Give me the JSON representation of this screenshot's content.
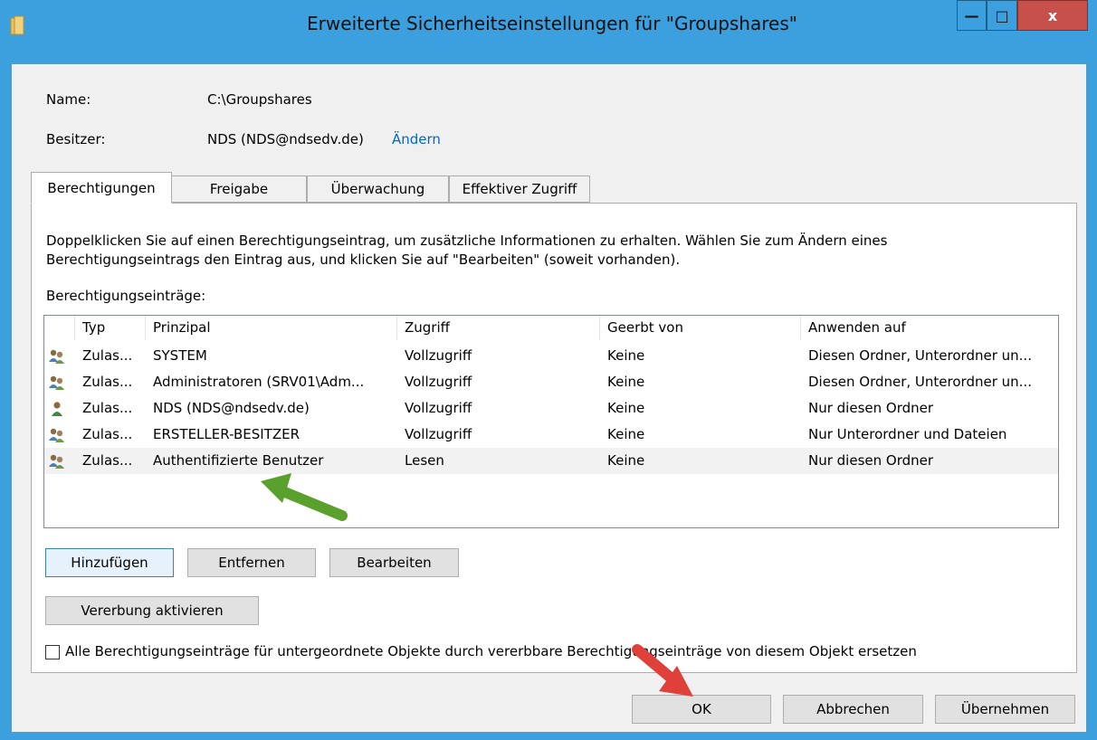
{
  "window": {
    "title": "Erweiterte Sicherheitseinstellungen für \"Groupshares\"",
    "minimize_glyph": "—",
    "maximize_glyph": "□",
    "close_glyph": "x"
  },
  "info": {
    "name_label": "Name:",
    "name_value": "C:\\Groupshares",
    "owner_label": "Besitzer:",
    "owner_value": "NDS (NDS@ndsedv.de)",
    "owner_change_link": "Ändern"
  },
  "tabs": [
    {
      "label": "Berechtigungen",
      "active": true
    },
    {
      "label": "Freigabe",
      "active": false
    },
    {
      "label": "Überwachung",
      "active": false
    },
    {
      "label": "Effektiver Zugriff",
      "active": false
    }
  ],
  "panel": {
    "description": "Doppelklicken Sie auf einen Berechtigungseintrag, um zusätzliche Informationen zu erhalten. Wählen Sie zum Ändern eines Berechtigungseintrags den Eintrag aus, und klicken Sie auf \"Bearbeiten\" (soweit vorhanden).",
    "description_line1": "Doppelklicken Sie auf einen Berechtigungseintrag, um zusätzliche Informationen zu erhalten. Wählen Sie zum Ändern eines",
    "description_line2": "Berechtigungseintrags den Eintrag aus, und klicken Sie auf \"Bearbeiten\" (soweit vorhanden).",
    "entries_label": "Berechtigungseinträge:"
  },
  "grid": {
    "columns": [
      "Typ",
      "Prinzipal",
      "Zugriff",
      "Geerbt von",
      "Anwenden auf"
    ],
    "rows": [
      {
        "icon": "group-users-icon",
        "type": "Zulas...",
        "principal": "SYSTEM",
        "access": "Vollzugriff",
        "inherited": "Keine",
        "applies": "Diesen Ordner, Unterordner un..."
      },
      {
        "icon": "group-users-icon",
        "type": "Zulas...",
        "principal": "Administratoren (SRV01\\Adm...",
        "access": "Vollzugriff",
        "inherited": "Keine",
        "applies": "Diesen Ordner, Unterordner un..."
      },
      {
        "icon": "single-user-icon",
        "type": "Zulas...",
        "principal": "NDS (NDS@ndsedv.de)",
        "access": "Vollzugriff",
        "inherited": "Keine",
        "applies": "Nur diesen Ordner"
      },
      {
        "icon": "group-users-icon",
        "type": "Zulas...",
        "principal": "ERSTELLER-BESITZER",
        "access": "Vollzugriff",
        "inherited": "Keine",
        "applies": "Nur Unterordner und Dateien"
      },
      {
        "icon": "group-users-icon",
        "type": "Zulas...",
        "principal": "Authentifizierte Benutzer",
        "access": "Lesen",
        "inherited": "Keine",
        "applies": "Nur diesen Ordner",
        "selected": true
      }
    ]
  },
  "buttons": {
    "add": "Hinzufügen",
    "remove": "Entfernen",
    "edit": "Bearbeiten",
    "enable_inheritance": "Vererbung aktivieren",
    "ok": "OK",
    "cancel": "Abbrechen",
    "apply": "Übernehmen"
  },
  "replace_checkbox": {
    "label": "Alle Berechtigungseinträge für untergeordnete Objekte durch vererbbare Berechtigungseinträge von diesem Objekt ersetzen",
    "checked": false
  },
  "colors": {
    "titlebar": "#3c9fde",
    "close_button": "#c7504b",
    "link": "#0066cc",
    "annotation_green_arrow": "#5aa02c",
    "annotation_red_arrow": "#e0403a"
  }
}
